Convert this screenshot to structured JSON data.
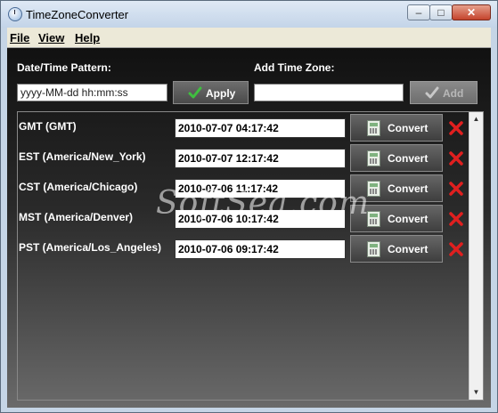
{
  "window": {
    "title": "TimeZoneConverter"
  },
  "menu": {
    "file": "File",
    "view": "View",
    "help": "Help"
  },
  "pattern": {
    "label": "Date/Time Pattern:",
    "value": "yyyy-MM-dd hh:mm:ss",
    "apply_label": "Apply"
  },
  "add_zone": {
    "label": "Add Time Zone:",
    "value": "",
    "add_label": "Add"
  },
  "convert_label": "Convert",
  "rows": [
    {
      "zone": "GMT (GMT)",
      "datetime": "2010-07-07 04:17:42"
    },
    {
      "zone": "EST (America/New_York)",
      "datetime": "2010-07-07 12:17:42"
    },
    {
      "zone": "CST (America/Chicago)",
      "datetime": "2010-07-06 11:17:42"
    },
    {
      "zone": "MST (America/Denver)",
      "datetime": "2010-07-06 10:17:42"
    },
    {
      "zone": "PST (America/Los_Angeles)",
      "datetime": "2010-07-06 09:17:42"
    }
  ],
  "watermark": "SoftSea.com",
  "colors": {
    "delete": "#e01f1f",
    "apply_check": "#3fbf3f"
  }
}
